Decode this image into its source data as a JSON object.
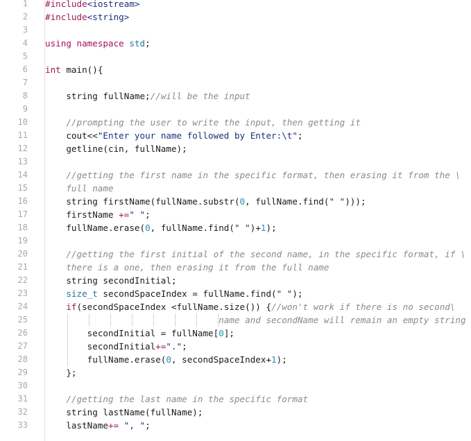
{
  "editor": {
    "language": "cpp",
    "lines": [
      {
        "n": "1",
        "tokens": [
          {
            "t": "pp",
            "v": "#include"
          },
          {
            "t": "pps",
            "v": "<iostream>"
          }
        ]
      },
      {
        "n": "2",
        "tokens": [
          {
            "t": "pp",
            "v": "#include"
          },
          {
            "t": "pps",
            "v": "<string>"
          }
        ]
      },
      {
        "n": "3",
        "tokens": []
      },
      {
        "n": "4",
        "tokens": [
          {
            "t": "kw",
            "v": "using"
          },
          {
            "t": "",
            "v": " "
          },
          {
            "t": "kw",
            "v": "namespace"
          },
          {
            "t": "",
            "v": " "
          },
          {
            "t": "ns",
            "v": "std"
          },
          {
            "t": "",
            "v": ";"
          }
        ]
      },
      {
        "n": "5",
        "tokens": []
      },
      {
        "n": "6",
        "tokens": [
          {
            "t": "ty",
            "v": "int"
          },
          {
            "t": "",
            "v": " main(){"
          }
        ]
      },
      {
        "n": "7",
        "tokens": [],
        "guides": 1
      },
      {
        "n": "8",
        "tokens": [
          {
            "t": "",
            "v": "    string fullName;"
          },
          {
            "t": "cm",
            "v": "//will be the input"
          }
        ],
        "guides": 1
      },
      {
        "n": "9",
        "tokens": [],
        "guides": 1
      },
      {
        "n": "10",
        "tokens": [
          {
            "t": "",
            "v": "    "
          },
          {
            "t": "cm",
            "v": "//prompting the user to write the input, then getting it"
          }
        ],
        "guides": 1
      },
      {
        "n": "11",
        "tokens": [
          {
            "t": "",
            "v": "    cout<<"
          },
          {
            "t": "str",
            "v": "\"Enter your name followed by Enter:\\t\""
          },
          {
            "t": "",
            "v": ";"
          }
        ],
        "guides": 1
      },
      {
        "n": "12",
        "tokens": [
          {
            "t": "",
            "v": "    getline(cin, fullName);"
          }
        ],
        "guides": 1
      },
      {
        "n": "13",
        "tokens": [],
        "guides": 1
      },
      {
        "n": "14",
        "tokens": [
          {
            "t": "",
            "v": "    "
          },
          {
            "t": "cm",
            "v": "//getting the first name in the specific format, then erasing it from the \\"
          }
        ],
        "guides": 1
      },
      {
        "n": "15",
        "tokens": [
          {
            "t": "",
            "v": "    "
          },
          {
            "t": "cm",
            "v": "full name"
          }
        ],
        "guides": 1
      },
      {
        "n": "16",
        "tokens": [
          {
            "t": "",
            "v": "    string firstName(fullName.substr("
          },
          {
            "t": "num",
            "v": "0"
          },
          {
            "t": "",
            "v": ", fullName.find("
          },
          {
            "t": "str",
            "v": "\" \""
          },
          {
            "t": "",
            "v": ")));"
          }
        ],
        "guides": 1
      },
      {
        "n": "17",
        "tokens": [
          {
            "t": "",
            "v": "    firstName "
          },
          {
            "t": "op",
            "v": "+="
          },
          {
            "t": "str",
            "v": "\" \""
          },
          {
            "t": "",
            "v": ";"
          }
        ],
        "guides": 1
      },
      {
        "n": "18",
        "tokens": [
          {
            "t": "",
            "v": "    fullName.erase("
          },
          {
            "t": "num",
            "v": "0"
          },
          {
            "t": "",
            "v": ", fullName.find("
          },
          {
            "t": "str",
            "v": "\" \""
          },
          {
            "t": "",
            "v": ")+"
          },
          {
            "t": "num",
            "v": "1"
          },
          {
            "t": "",
            "v": ");"
          }
        ],
        "guides": 1
      },
      {
        "n": "19",
        "tokens": [],
        "guides": 1
      },
      {
        "n": "20",
        "tokens": [
          {
            "t": "",
            "v": "    "
          },
          {
            "t": "cm",
            "v": "//getting the first initial of the second name, in the specific format, if \\"
          }
        ],
        "guides": 1
      },
      {
        "n": "21",
        "tokens": [
          {
            "t": "",
            "v": "    "
          },
          {
            "t": "cm",
            "v": "there is a one, then erasing it from the full name"
          }
        ],
        "guides": 1
      },
      {
        "n": "22",
        "tokens": [
          {
            "t": "",
            "v": "    string secondInitial;"
          }
        ],
        "guides": 1
      },
      {
        "n": "23",
        "tokens": [
          {
            "t": "",
            "v": "    "
          },
          {
            "t": "ns",
            "v": "size_t"
          },
          {
            "t": "",
            "v": " secondSpaceIndex = fullName.find("
          },
          {
            "t": "str",
            "v": "\" \""
          },
          {
            "t": "",
            "v": ");"
          }
        ],
        "guides": 1
      },
      {
        "n": "24",
        "tokens": [
          {
            "t": "",
            "v": "    "
          },
          {
            "t": "kw",
            "v": "if"
          },
          {
            "t": "",
            "v": "(secondSpaceIndex <fullName.size()) {"
          },
          {
            "t": "cm",
            "v": "//won't work if there is no second\\"
          }
        ],
        "guides": 1
      },
      {
        "n": "25",
        "tokens": [
          {
            "t": "",
            "v": "                                 "
          },
          {
            "t": "cm",
            "v": "name and secondName will remain an empty string"
          }
        ],
        "guides": 9
      },
      {
        "n": "26",
        "tokens": [
          {
            "t": "",
            "v": "        secondInitial = fullName["
          },
          {
            "t": "num",
            "v": "0"
          },
          {
            "t": "",
            "v": "];"
          }
        ],
        "guides": 2
      },
      {
        "n": "27",
        "tokens": [
          {
            "t": "",
            "v": "        secondInitial"
          },
          {
            "t": "op",
            "v": "+="
          },
          {
            "t": "str",
            "v": "\".\""
          },
          {
            "t": "",
            "v": ";"
          }
        ],
        "guides": 2
      },
      {
        "n": "28",
        "tokens": [
          {
            "t": "",
            "v": "        fullName.erase("
          },
          {
            "t": "num",
            "v": "0"
          },
          {
            "t": "",
            "v": ", secondSpaceIndex+"
          },
          {
            "t": "num",
            "v": "1"
          },
          {
            "t": "",
            "v": ");"
          }
        ],
        "guides": 2
      },
      {
        "n": "29",
        "tokens": [
          {
            "t": "",
            "v": "    };"
          }
        ],
        "guides": 1
      },
      {
        "n": "30",
        "tokens": [],
        "guides": 1
      },
      {
        "n": "31",
        "tokens": [
          {
            "t": "",
            "v": "    "
          },
          {
            "t": "cm",
            "v": "//getting the last name in the specific format"
          }
        ],
        "guides": 1
      },
      {
        "n": "32",
        "tokens": [
          {
            "t": "",
            "v": "    string lastName(fullName);"
          }
        ],
        "guides": 1
      },
      {
        "n": "33",
        "tokens": [
          {
            "t": "",
            "v": "    lastName"
          },
          {
            "t": "op",
            "v": "+="
          },
          {
            "t": "",
            "v": " "
          },
          {
            "t": "str",
            "v": "\", \""
          },
          {
            "t": "",
            "v": ";"
          }
        ],
        "guides": 1
      }
    ]
  },
  "colors": {
    "keyword": "#a1105a",
    "type": "#9c1b57",
    "namespace": "#20789a",
    "number": "#2a8db0",
    "string": "#1c2f7a",
    "comment": "#8a8a8a",
    "line_number": "#a8a8a8",
    "background": "#ffffff"
  }
}
